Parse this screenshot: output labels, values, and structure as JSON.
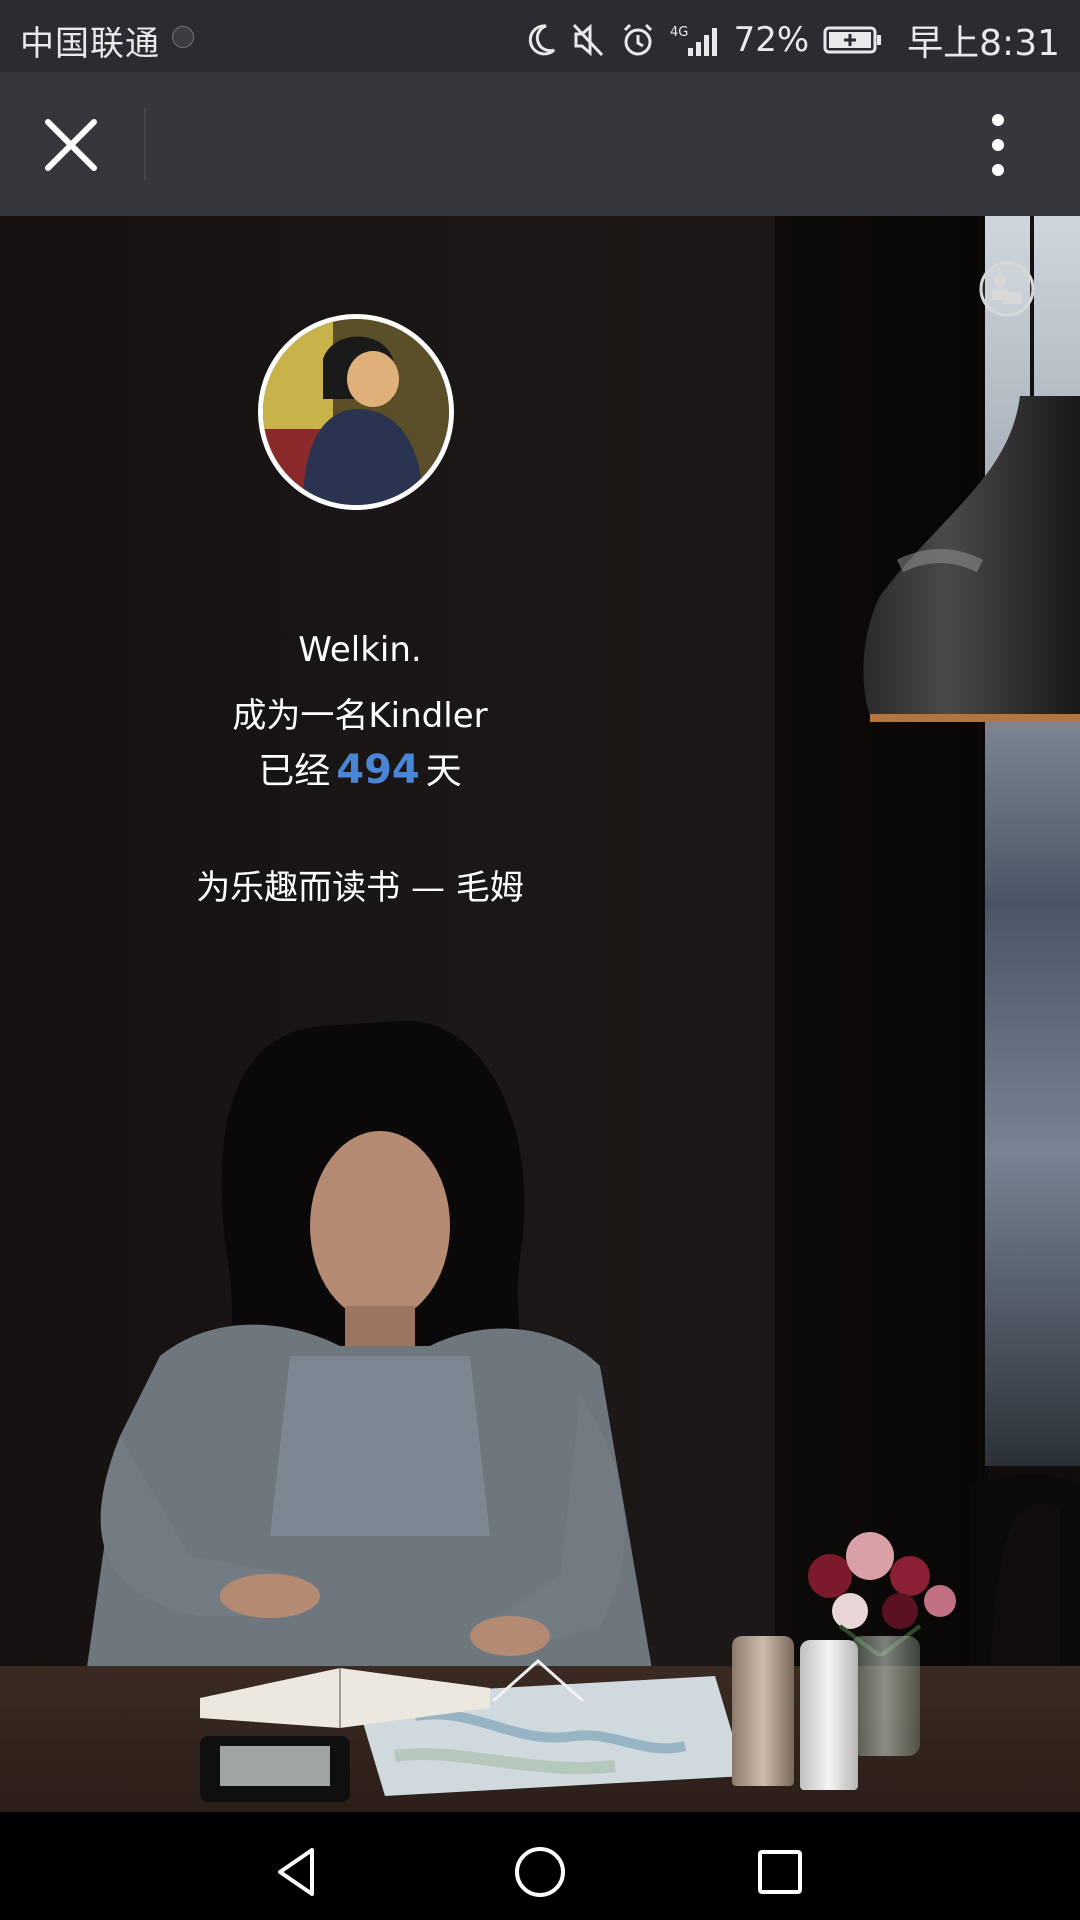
{
  "status_bar": {
    "carrier": "中国联通",
    "network": "4G",
    "battery_percent": "72%",
    "time": "早上8:31"
  },
  "toolbar": {
    "close_icon": "close-icon",
    "more_icon": "more-vertical-icon"
  },
  "profile": {
    "name": "Welkin.",
    "kindler_line": "成为一名Kindler",
    "days_prefix": "已经",
    "days_count": "494",
    "days_suffix": "天",
    "quote": "为乐趣而读书 — 毛姆"
  },
  "colors": {
    "accent": "#4a86d8",
    "status_bar_bg": "#2b2c31",
    "toolbar_bg": "#36373c"
  },
  "icons": {
    "switch": "switch-account-icon",
    "scroll": "chevron-up-icon",
    "nav_back": "back-triangle-icon",
    "nav_home": "home-circle-icon",
    "nav_recent": "recent-square-icon"
  }
}
